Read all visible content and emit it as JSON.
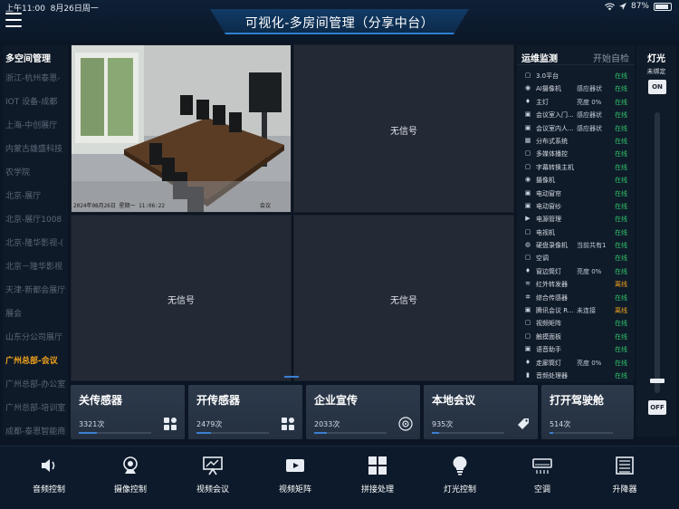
{
  "statusbar": {
    "time": "上午11:00",
    "date": "8月26日周一",
    "battery": "87%",
    "battery_level": 0.87
  },
  "header": {
    "title": "可视化-多房间管理（分享中台）"
  },
  "left_panel": {
    "title": "多空间管理",
    "rooms": [
      {
        "label": "浙江-杭州泰恩-",
        "active": false
      },
      {
        "label": "IOT 设备-成都",
        "active": false
      },
      {
        "label": "上海-中创展厅",
        "active": false
      },
      {
        "label": "内蒙古雄盛科技",
        "active": false
      },
      {
        "label": "农学院",
        "active": false
      },
      {
        "label": "北京-展厅",
        "active": false
      },
      {
        "label": "北京-展厅1008",
        "active": false
      },
      {
        "label": "北京-隆华影视-(",
        "active": false
      },
      {
        "label": "北京－隆华影视",
        "active": false
      },
      {
        "label": "天津-新都会展厅",
        "active": false
      },
      {
        "label": "展会",
        "active": false
      },
      {
        "label": "山东分公司展厅",
        "active": false
      },
      {
        "label": "广州总部-会议",
        "active": true
      },
      {
        "label": "广州总部-办公室",
        "active": false
      },
      {
        "label": "广州总部-培训室",
        "active": false
      },
      {
        "label": "成都-泰恩智能商",
        "active": false
      }
    ]
  },
  "video": {
    "timestamp": "2024年08月26日 星期一 11:06:22",
    "cam_label": "会议",
    "no_signal": "无信号"
  },
  "monitor": {
    "title": "运维监测",
    "action": "开始自检",
    "devices": [
      {
        "icon": "square",
        "name": "3.0平台",
        "extra": "",
        "status": "在线",
        "state": "on"
      },
      {
        "icon": "camera",
        "name": "AI摄像机",
        "extra": "感应器状",
        "status": "在线",
        "state": "on"
      },
      {
        "icon": "bulb",
        "name": "主灯",
        "extra": "亮度 0%",
        "status": "在线",
        "state": "on"
      },
      {
        "icon": "chip",
        "name": "会议室入门...",
        "extra": "感应器状",
        "status": "在线",
        "state": "on"
      },
      {
        "icon": "chip",
        "name": "会议室内人...",
        "extra": "感应器状",
        "status": "在线",
        "state": "on"
      },
      {
        "icon": "grid",
        "name": "分布式系统",
        "extra": "",
        "status": "在线",
        "state": "on"
      },
      {
        "icon": "square",
        "name": "多媒体播控",
        "extra": "",
        "status": "在线",
        "state": "on"
      },
      {
        "icon": "square",
        "name": "字幕转换主机",
        "extra": "",
        "status": "在线",
        "state": "on"
      },
      {
        "icon": "camera",
        "name": "摄像机",
        "extra": "",
        "status": "在线",
        "state": "on"
      },
      {
        "icon": "chip",
        "name": "电动窗帘",
        "extra": "",
        "status": "在线",
        "state": "on"
      },
      {
        "icon": "chip",
        "name": "电动窗纱",
        "extra": "",
        "status": "在线",
        "state": "on"
      },
      {
        "icon": "play",
        "name": "电源管理",
        "extra": "",
        "status": "在线",
        "state": "on"
      },
      {
        "icon": "square",
        "name": "电视机",
        "extra": "",
        "status": "在线",
        "state": "on"
      },
      {
        "icon": "disk",
        "name": "硬盘录像机",
        "extra": "当前共有1",
        "status": "在线",
        "state": "on"
      },
      {
        "icon": "square",
        "name": "空调",
        "extra": "",
        "status": "在线",
        "state": "on"
      },
      {
        "icon": "bulb",
        "name": "窗边筒灯",
        "extra": "亮度 0%",
        "status": "在线",
        "state": "on"
      },
      {
        "icon": "wave",
        "name": "红外转发器",
        "extra": "",
        "status": "离线",
        "state": "off"
      },
      {
        "icon": "gear",
        "name": "综合传感器",
        "extra": "",
        "status": "在线",
        "state": "on"
      },
      {
        "icon": "chip",
        "name": "腾讯会议 R...",
        "extra": "未连接",
        "status": "离线",
        "state": "off"
      },
      {
        "icon": "square",
        "name": "视频矩阵",
        "extra": "",
        "status": "在线",
        "state": "on"
      },
      {
        "icon": "square",
        "name": "触摸面板",
        "extra": "",
        "status": "在线",
        "state": "on"
      },
      {
        "icon": "chip",
        "name": "语音助手",
        "extra": "",
        "status": "在线",
        "state": "on"
      },
      {
        "icon": "bulb",
        "name": "走廊筒灯",
        "extra": "亮度 0%",
        "status": "在线",
        "state": "on"
      },
      {
        "icon": "bars",
        "name": "音频处理器",
        "extra": "",
        "status": "在线",
        "state": "on"
      }
    ]
  },
  "light": {
    "title": "灯光",
    "subtitle": "未绑定",
    "on_label": "ON",
    "off_label": "OFF",
    "level": 0.0
  },
  "cards": [
    {
      "label": "关传感器",
      "count": "3321次",
      "icon": "grid-icon",
      "progress": 0.25
    },
    {
      "label": "开传感器",
      "count": "2479次",
      "icon": "grid-icon",
      "progress": 0.2
    },
    {
      "label": "企业宣传",
      "count": "2033次",
      "icon": "target-icon",
      "progress": 0.18
    },
    {
      "label": "本地会议",
      "count": "935次",
      "icon": "tag-icon",
      "progress": 0.1
    },
    {
      "label": "打开驾驶舱",
      "count": "514次",
      "icon": "",
      "progress": 0.05
    }
  ],
  "nav": [
    {
      "label": "音频控制",
      "icon": "speaker-icon"
    },
    {
      "label": "摄像控制",
      "icon": "webcam-icon"
    },
    {
      "label": "视频会议",
      "icon": "screen-icon"
    },
    {
      "label": "视频矩阵",
      "icon": "video-icon"
    },
    {
      "label": "拼接处理",
      "icon": "tiles-icon"
    },
    {
      "label": "灯光控制",
      "icon": "bulb-icon"
    },
    {
      "label": "空调",
      "icon": "ac-icon"
    },
    {
      "label": "升降器",
      "icon": "lift-icon"
    }
  ]
}
